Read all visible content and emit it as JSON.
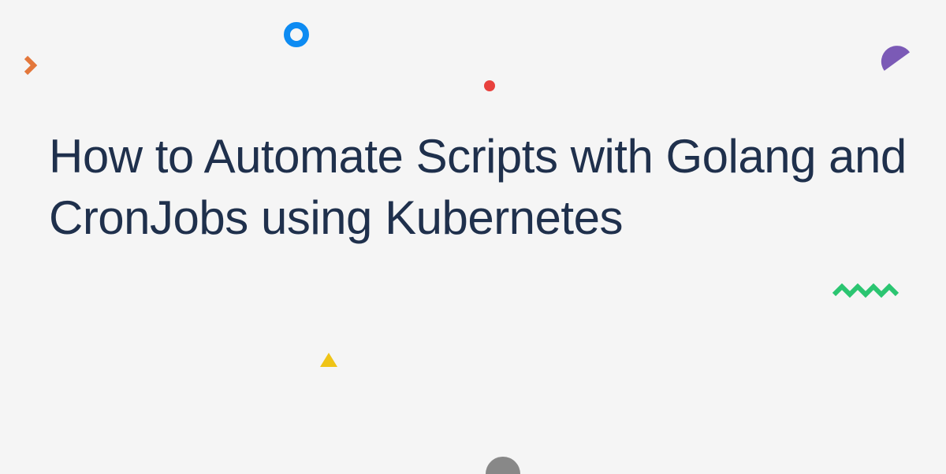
{
  "title": "How to Automate Scripts with Golang and CronJobs using Kubernetes",
  "decor": {
    "chevron_color": "#e3773b",
    "ring_color": "#0d8bf2",
    "dot_color": "#e8413d",
    "quarter_color": "#7b5ab6",
    "triangle_color": "#efc417",
    "zigzag_color": "#2bc571",
    "halfcircle_color": "#888888"
  }
}
